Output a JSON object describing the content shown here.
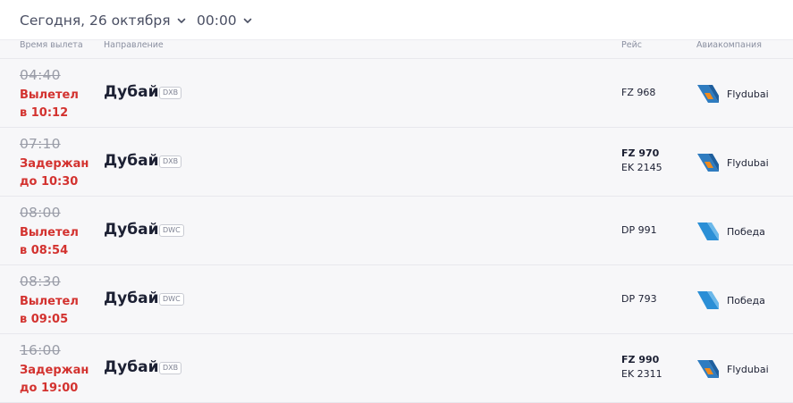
{
  "header": {
    "date_label": "Сегодня, 26 октября",
    "time_label": "00:00"
  },
  "columns": {
    "time": "Время вылета",
    "destination": "Направление",
    "flight": "Рейс",
    "airline": "Авиакомпания"
  },
  "flights": [
    {
      "scheduled": "04:40",
      "status_line1": "Вылетел",
      "status_line2": "в 10:12",
      "city": "Дубай",
      "iata": "DXB",
      "flight_main": "FZ 968",
      "flight_codeshare": "",
      "airline": "Flydubai",
      "airline_icon": "flydubai-logo-icon"
    },
    {
      "scheduled": "07:10",
      "status_line1": "Задержан",
      "status_line2": "до 10:30",
      "city": "Дубай",
      "iata": "DXB",
      "flight_main": "FZ 970",
      "flight_codeshare": "EK 2145",
      "airline": "Flydubai",
      "airline_icon": "flydubai-logo-icon"
    },
    {
      "scheduled": "08:00",
      "status_line1": "Вылетел",
      "status_line2": "в 08:54",
      "city": "Дубай",
      "iata": "DWC",
      "flight_main": "DP 991",
      "flight_codeshare": "",
      "airline": "Победа",
      "airline_icon": "pobeda-logo-icon"
    },
    {
      "scheduled": "08:30",
      "status_line1": "Вылетел",
      "status_line2": "в 09:05",
      "city": "Дубай",
      "iata": "DWC",
      "flight_main": "DP 793",
      "flight_codeshare": "",
      "airline": "Победа",
      "airline_icon": "pobeda-logo-icon"
    },
    {
      "scheduled": "16:00",
      "status_line1": "Задержан",
      "status_line2": "до 19:00",
      "city": "Дубай",
      "iata": "DXB",
      "flight_main": "FZ 990",
      "flight_codeshare": "EK 2311",
      "airline": "Flydubai",
      "airline_icon": "flydubai-logo-icon"
    }
  ],
  "colors": {
    "status_red": "#d3322f",
    "flydubai_blue": "#2f7cc0",
    "flydubai_orange": "#f08a1c",
    "pobeda_blue": "#2b8fd6"
  }
}
